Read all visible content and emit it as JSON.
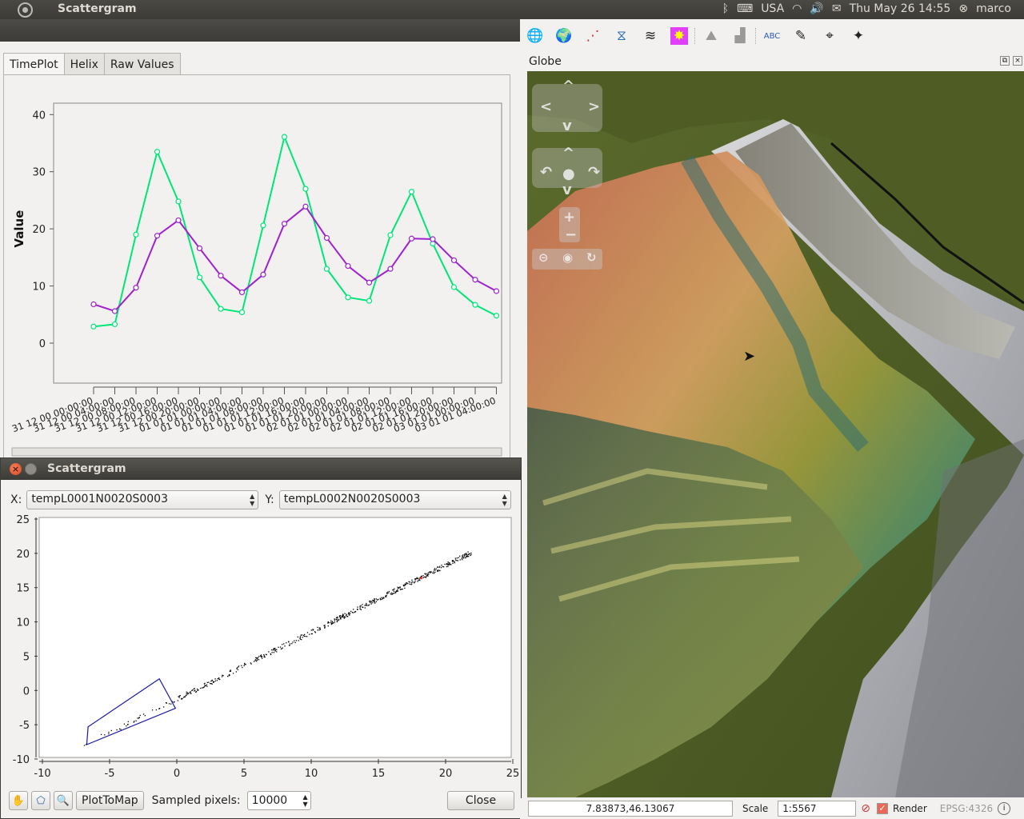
{
  "top_panel": {
    "app_title": "Scattergram",
    "keyboard": "USA",
    "clock": "Thu May 26 14:55",
    "user": "marco"
  },
  "timeplot": {
    "tabs": [
      "TimePlot",
      "Helix",
      "Raw Values"
    ],
    "active_tab": "TimePlot",
    "chart_data": {
      "type": "line",
      "ylabel": "Value",
      "ylim": [
        -7,
        42
      ],
      "yticks": [
        0,
        10,
        20,
        30,
        40
      ],
      "categories": [
        "31 12 00 00:00:00",
        "31 12 00 04:00:00",
        "31 12 00 08:00:00",
        "31 12 00 12:00:00",
        "31 12 00 16:00:00",
        "31 12 00 20:00:00",
        "01 01 01 00:00:00",
        "01 01 01 04:00:00",
        "01 01 01 08:00:00",
        "01 01 01 12:00:00",
        "01 01 01 16:00:00",
        "01 01 01 20:00:00",
        "02 01 01 00:00:00",
        "02 01 01 04:00:00",
        "02 01 01 08:00:00",
        "02 01 01 12:00:00",
        "02 01 01 16:00:00",
        "02 01 01 20:00:00",
        "03 01 01 00:00:00",
        "03 01 01 04:00:00"
      ],
      "series": [
        {
          "color": "#00e676",
          "values": [
            2.9,
            3.3,
            19,
            33.5,
            24.8,
            11.5,
            6,
            5.4,
            20.6,
            36.1,
            27,
            13,
            8,
            7.4,
            18.9,
            26.5,
            17.4,
            9.8,
            6.7,
            4.8
          ]
        },
        {
          "color": "#a020d0",
          "values": [
            6.8,
            5.6,
            9.7,
            18.8,
            21.5,
            16.6,
            11.8,
            8.9,
            12,
            20.9,
            23.9,
            18.4,
            13.5,
            10.6,
            13,
            18.3,
            18.2,
            14.5,
            11.1,
            9.1
          ]
        }
      ]
    }
  },
  "scattergram": {
    "title": "Scattergram",
    "x_label": "X:",
    "x_value": "tempL0001N0020S0003",
    "y_label": "Y:",
    "y_value": "tempL0002N0020S0003",
    "chart_data": {
      "type": "scatter",
      "xlim": [
        -10,
        25
      ],
      "ylim": [
        -10,
        25
      ],
      "xticks": [
        -10,
        -5,
        0,
        5,
        10,
        15,
        20,
        25
      ],
      "yticks": [
        -10,
        -5,
        0,
        5,
        10,
        15,
        20,
        25
      ],
      "trend": {
        "x_start": -7,
        "y_start": -8,
        "x_end": 22,
        "y_end": 20.3
      },
      "selection_polygon": [
        [
          -6.6,
          -5.3
        ],
        [
          -1.3,
          1.7
        ],
        [
          -0.1,
          -2.6
        ],
        [
          -6.7,
          -7.9
        ]
      ],
      "highlight_point": {
        "x": 18.2,
        "y": 16.4,
        "color": "#e53935"
      }
    },
    "plot_to_map": "PlotToMap",
    "sampled_label": "Sampled pixels:",
    "sampled_value": "10000",
    "close_label": "Close"
  },
  "globe": {
    "title": "Globe",
    "coords": "7.83873,46.13067",
    "scale_label": "Scale",
    "scale_value": "1:5567",
    "render_label": "Render",
    "crs": "EPSG:4326"
  }
}
